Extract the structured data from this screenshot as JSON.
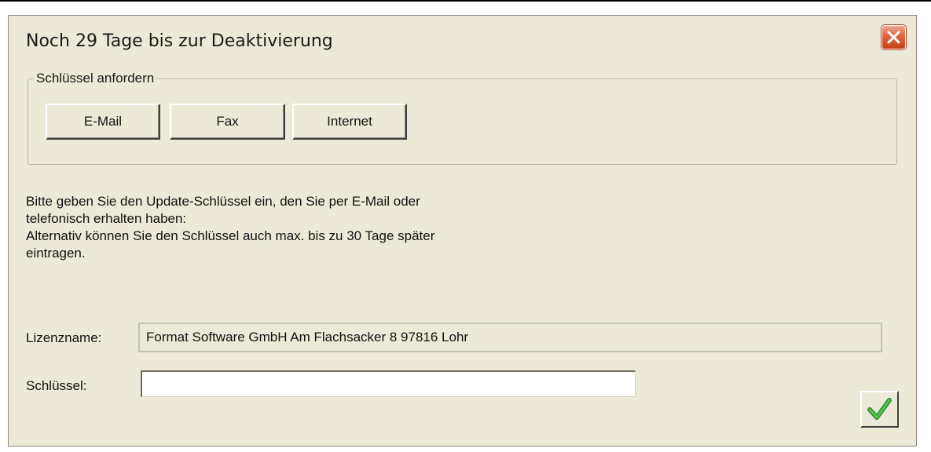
{
  "dialog": {
    "title": "Noch 29 Tage bis zur Deaktivierung",
    "close_icon": "close-icon"
  },
  "request_group": {
    "legend": "Schlüssel anfordern",
    "buttons": [
      "E-Mail",
      "Fax",
      "Internet"
    ]
  },
  "info_lines": [
    "Bitte geben Sie den Update-Schlüssel ein, den Sie per E-Mail oder",
    "telefonisch erhalten haben:",
    "Alternativ können Sie den Schlüssel auch max. bis zu 30 Tage später",
    "eintragen."
  ],
  "license": {
    "label": "Lizenzname:",
    "value": "Format Software GmbH Am Flachsacker 8 97816 Lohr"
  },
  "key": {
    "label": "Schlüssel:",
    "value": ""
  },
  "ok_icon": "checkmark-icon",
  "colors": {
    "dialog_bg": "#ece9d8",
    "close_red": "#e0623c",
    "check_green": "#3aa33a"
  }
}
